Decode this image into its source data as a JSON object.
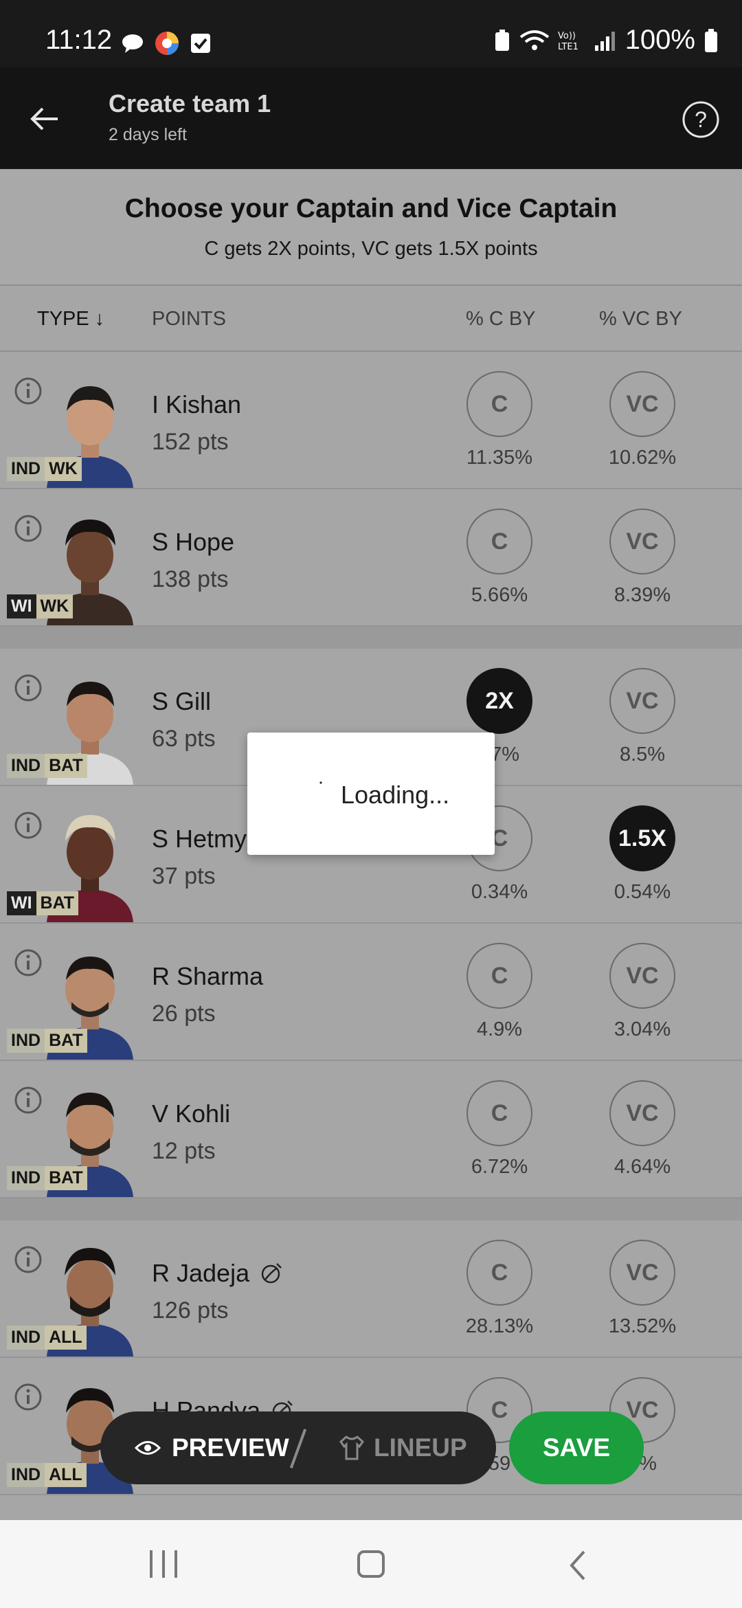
{
  "status_bar": {
    "time": "11:12",
    "battery": "100%"
  },
  "header": {
    "title": "Create team 1",
    "subtitle": "2 days left"
  },
  "instruction": {
    "title": "Choose your Captain and Vice Captain",
    "subtitle": "C gets 2X points, VC gets 1.5X points"
  },
  "columns": {
    "type": "TYPE ↓",
    "points": "POINTS",
    "c_by": "% C BY",
    "vc_by": "% VC BY"
  },
  "players": [
    {
      "name": "I Kishan",
      "pts": "152 pts",
      "team": "IND",
      "role": "WK",
      "c_label": "C",
      "vc_label": "VC",
      "c_pct": "11.35%",
      "vc_pct": "10.62%"
    },
    {
      "name": "S Hope",
      "pts": "138 pts",
      "team": "WI",
      "role": "WK",
      "c_label": "C",
      "vc_label": "VC",
      "c_pct": "5.66%",
      "vc_pct": "8.39%"
    },
    {
      "name": "S Gill",
      "pts": "63 pts",
      "team": "IND",
      "role": "BAT",
      "c_label": "2X",
      "vc_label": "VC",
      "c_pct": "57%",
      "vc_pct": "8.5%"
    },
    {
      "name": "S Hetmy",
      "pts": "37 pts",
      "team": "WI",
      "role": "BAT",
      "c_label": "C",
      "vc_label": "1.5X",
      "c_pct": "0.34%",
      "vc_pct": "0.54%"
    },
    {
      "name": "R Sharma",
      "pts": "26 pts",
      "team": "IND",
      "role": "BAT",
      "c_label": "C",
      "vc_label": "VC",
      "c_pct": "4.9%",
      "vc_pct": "3.04%"
    },
    {
      "name": "V Kohli",
      "pts": "12 pts",
      "team": "IND",
      "role": "BAT",
      "c_label": "C",
      "vc_label": "VC",
      "c_pct": "6.72%",
      "vc_pct": "4.64%"
    },
    {
      "name": "R Jadeja",
      "pts": "126 pts",
      "team": "IND",
      "role": "ALL",
      "c_label": "C",
      "vc_label": "VC",
      "c_pct": "28.13%",
      "vc_pct": "13.52%"
    },
    {
      "name": "H Pandya",
      "pts": "",
      "team": "IND",
      "role": "ALL",
      "c_label": "C",
      "vc_label": "VC",
      "c_pct": "59",
      "vc_pct": "7%"
    }
  ],
  "loading": {
    "text": "Loading..."
  },
  "bottom": {
    "preview": "PREVIEW",
    "lineup": "LINEUP",
    "save": "SAVE"
  },
  "colors": {
    "save": "#1a9e3e",
    "selected": "#141414"
  }
}
